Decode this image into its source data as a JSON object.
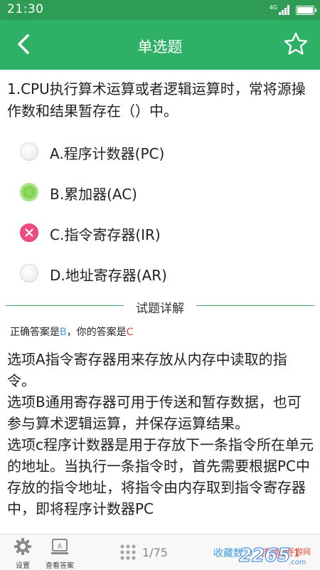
{
  "status_bar": {
    "time": "21:30",
    "network": "4G"
  },
  "app_bar": {
    "title": "单选题",
    "back_icon": "chevron-left-icon",
    "favorite_icon": "star-outline-icon"
  },
  "question": {
    "text": "1.CPU执行算术运算或者逻辑运算时，常将源操作数和结果暂存在（）中。"
  },
  "options": [
    {
      "label": "A.程序计数器(PC)",
      "state": "unselected"
    },
    {
      "label": "B.累加器(AC)",
      "state": "correct"
    },
    {
      "label": "C.指令寄存器(IR)",
      "state": "wrong"
    },
    {
      "label": "D.地址寄存器(AR)",
      "state": "unselected"
    }
  ],
  "detail": {
    "section_title": "试题详解",
    "correct_prefix": "正确答案是",
    "correct_answer": "B",
    "your_prefix": "，你的答案是",
    "your_answer": "C",
    "paragraphs": [
      "选项A指令寄存器用来存放从内存中读取的指令。",
      "选项B通用寄存器可用于传送和暂存数据，也可参与算术逻辑运算，并保存运算结果。",
      "选项c程序计数器是用于存放下一条指令所在单元的地址。当执行一条指令时，首先需要根据PC中存放的指令地址，将指令由内存取到指令寄存器中，即将程序计数器PC"
    ]
  },
  "bottom_bar": {
    "settings_label": "设置",
    "view_answer_label": "查看答案",
    "page_indicator": "1/75",
    "favorites_count": "收藏数:0",
    "errors_count": "错题数:1"
  },
  "watermark": {
    "number": "2265",
    "text": "手游网",
    "domain": ".com"
  },
  "colors": {
    "status_bar": "#2e9c55",
    "app_bar": "#2eb067",
    "correct_answer": "#3fa0e0",
    "wrong_answer": "#e43f3f",
    "wrong_radio": "#ec4c7e",
    "correct_radio": "#7fd24d"
  }
}
